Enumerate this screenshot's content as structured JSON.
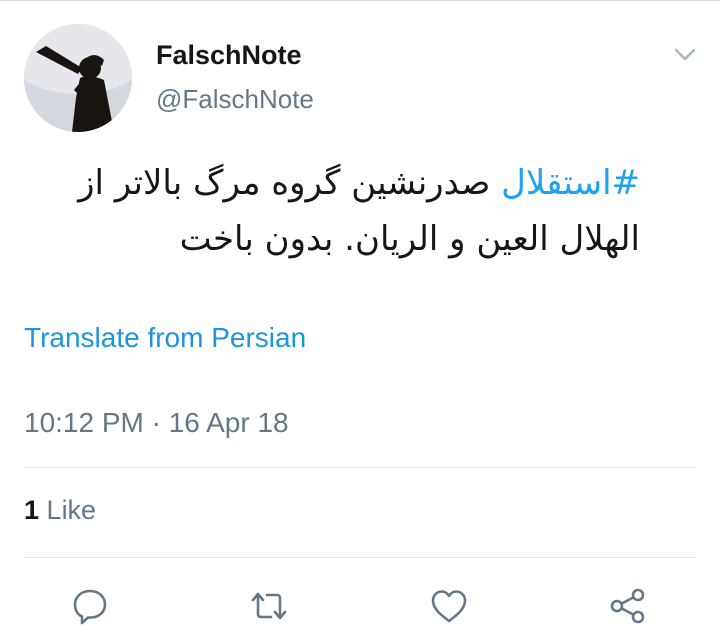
{
  "tweet": {
    "display_name": "FalschNote",
    "handle": "@FalschNote",
    "hashtag": "#استقلال",
    "text_line1": "صدرنشین گروه مرگ بالاتر از",
    "text_line2": "الهلال العین و الریان. بدون باخت",
    "translate_label": "Translate from Persian",
    "timestamp": "10:12 PM · 16 Apr 18",
    "likes_count": "1",
    "likes_label": "Like"
  },
  "icons": {
    "menu": "chevron-down-icon",
    "reply": "reply-icon",
    "retweet": "retweet-icon",
    "like": "heart-icon",
    "share": "share-icon"
  },
  "colors": {
    "link": "#1b95e0",
    "hashtag": "#1da1f2",
    "secondary_text": "#657786",
    "primary_text": "#14171a",
    "divider": "#e1e8ed"
  }
}
